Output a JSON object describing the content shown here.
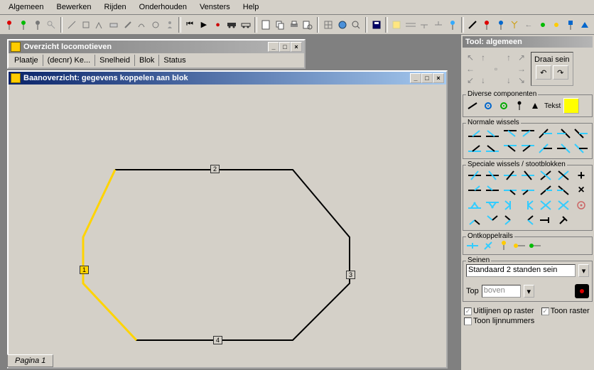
{
  "menu": {
    "algemeen": "Algemeen",
    "bewerken": "Bewerken",
    "rijden": "Rijden",
    "onderhouden": "Onderhouden",
    "vensters": "Vensters",
    "help": "Help"
  },
  "win_loco": {
    "title": "Overzicht locomotieven",
    "col_plaatje": "Plaatje",
    "col_decnr": "(decnr) Ke...",
    "col_snelheid": "Snelheid",
    "col_blok": "Blok",
    "col_status": "Status"
  },
  "win_baan": {
    "title": "Baanoverzicht: gegevens koppelen aan blok"
  },
  "blocks": {
    "b1": "1",
    "b2": "2",
    "b3": "3",
    "b4": "4"
  },
  "tab": "Pagina 1",
  "tool": {
    "title": "Tool: algemeen",
    "draai": "Draai sein",
    "diverse": "Diverse componenten",
    "tekst": "Tekst",
    "normale": "Normale wissels",
    "speciale": "Speciale wissels / stootblokken",
    "ontkoppel": "Ontkoppelrails",
    "seinen": "Seinen",
    "sein_value": "Standaard 2 standen sein",
    "top_label": "Top",
    "top_value": "boven",
    "cb_uitlijnen": "Uitlijnen op raster",
    "cb_toonraster": "Toon raster",
    "cb_toonlijn": "Toon lijnnummers"
  }
}
